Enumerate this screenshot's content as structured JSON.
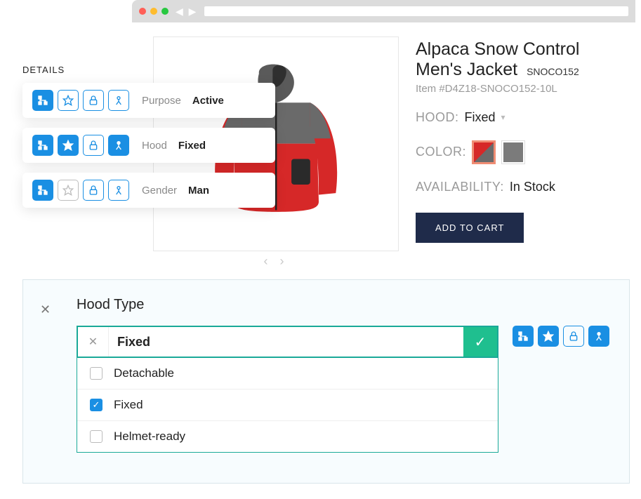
{
  "details": {
    "heading": "DETAILS",
    "items": [
      {
        "label": "Purpose",
        "value": "Active"
      },
      {
        "label": "Hood",
        "value": "Fixed"
      },
      {
        "label": "Gender",
        "value": "Man"
      }
    ]
  },
  "product": {
    "title_line1": "Alpaca Snow Control",
    "title_line2": "Men's Jacket",
    "sku": "SNOCO152",
    "item_number": "Item #D4Z18-SNOCO152-10L",
    "hood_label": "HOOD:",
    "hood_value": "Fixed",
    "color_label": "COLOR:",
    "availability_label": "AVAILABILITY:",
    "availability_value": "In Stock",
    "add_to_cart": "ADD TO CART",
    "swatches": [
      {
        "name": "red-grey",
        "selected": true
      },
      {
        "name": "grey",
        "selected": false
      }
    ]
  },
  "editor": {
    "title": "Hood Type",
    "input_value": "Fixed",
    "options": [
      {
        "label": "Detachable",
        "checked": false
      },
      {
        "label": "Fixed",
        "checked": true
      },
      {
        "label": "Helmet-ready",
        "checked": false
      }
    ]
  },
  "icons": {
    "hierarchy": "hierarchy-icon",
    "star": "star-icon",
    "lock": "lock-icon",
    "person": "person-icon"
  }
}
